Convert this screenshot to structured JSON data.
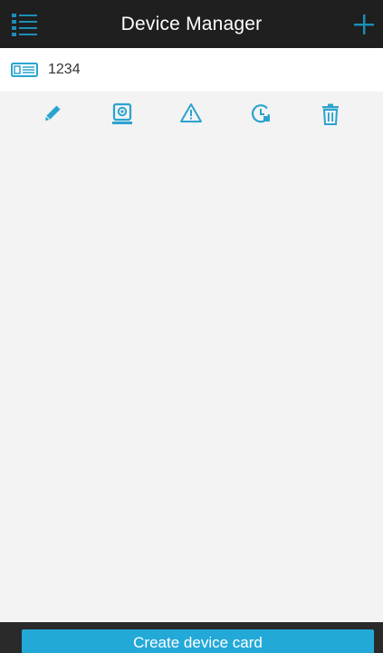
{
  "header": {
    "title": "Device Manager",
    "menu_icon": "list-menu-icon",
    "add_icon": "plus-icon"
  },
  "device": {
    "name": "1234",
    "icon": "dvr-device-icon"
  },
  "actions": [
    {
      "icon": "pencil-icon"
    },
    {
      "icon": "camera-icon"
    },
    {
      "icon": "warning-icon"
    },
    {
      "icon": "clock-icon"
    },
    {
      "icon": "trash-icon"
    }
  ],
  "footer": {
    "create_label": "Create device card"
  },
  "colors": {
    "accent": "#23a9d8",
    "header_bg": "#1f1f1f",
    "content_bg": "#f3f3f3"
  }
}
